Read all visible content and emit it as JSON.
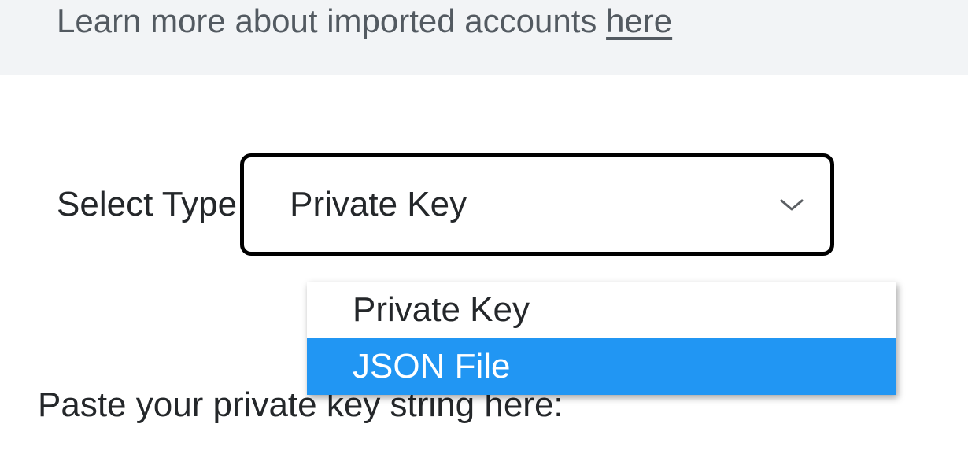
{
  "info": {
    "text_prefix": "Learn more about imported accounts ",
    "link_text": "here"
  },
  "select": {
    "label": "Select Type",
    "value": "Private Key",
    "options": {
      "opt0": "Private Key",
      "opt1": "JSON File"
    }
  },
  "paste_label": "Paste your private key string here:"
}
